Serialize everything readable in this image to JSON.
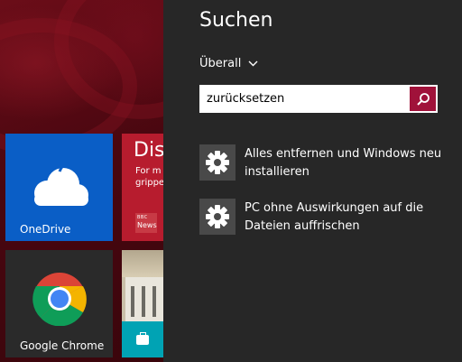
{
  "start_screen": {
    "tiles": {
      "onedrive": {
        "label": "OneDrive",
        "icon": "cloud-icon",
        "color": "#0a5ec6"
      },
      "chrome": {
        "label": "Google Chrome",
        "icon": "chrome-logo-icon",
        "color": "#2a2a2a"
      },
      "news": {
        "title": "Disc",
        "text_line1": "For m",
        "text_line2": "grippe",
        "badge_line1": "BBC",
        "badge_line2": "News",
        "color": "#b71c2e"
      },
      "travel": {
        "icon": "suitcase-icon",
        "color": "#00a3b4"
      }
    }
  },
  "search_pane": {
    "title": "Suchen",
    "scope": {
      "label": "Überall",
      "icon": "chevron-down-icon"
    },
    "search": {
      "value": "zurücksetzen",
      "button_icon": "search-icon",
      "accent": "#a0123a"
    },
    "results": [
      {
        "label_line1": "Alles entfernen und Windows neu",
        "label_line2": "installieren",
        "icon": "gear-icon"
      },
      {
        "label_line1": "PC ohne Auswirkungen auf die",
        "label_line2": "Dateien auffrischen",
        "icon": "gear-icon"
      }
    ]
  }
}
